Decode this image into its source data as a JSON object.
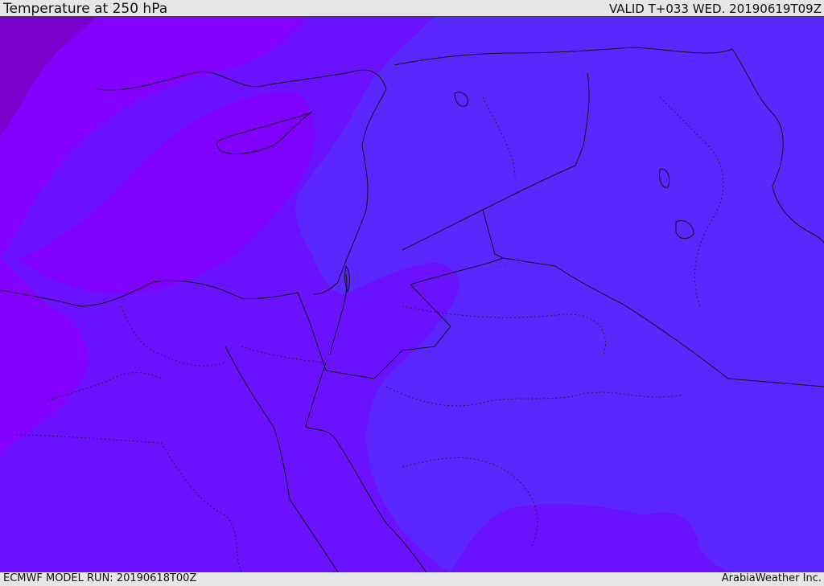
{
  "header": {
    "title": "Temperature at 250 hPa",
    "valid": "VALID T+033 WED. 20190619T09Z"
  },
  "footer": {
    "model_run": "ECMWF MODEL RUN: 20190618T00Z",
    "credit": "ArabiaWeather Inc."
  },
  "map": {
    "field": "Temperature",
    "level": "250 hPa",
    "colors": {
      "warmest_band": "#7a00cc",
      "warm_band": "#8400ff",
      "mid_band": "#6a12ff",
      "cool_band": "#5a28ff",
      "coastline": "#111111",
      "borders": "#111111",
      "admin_lines": "#222222"
    }
  }
}
